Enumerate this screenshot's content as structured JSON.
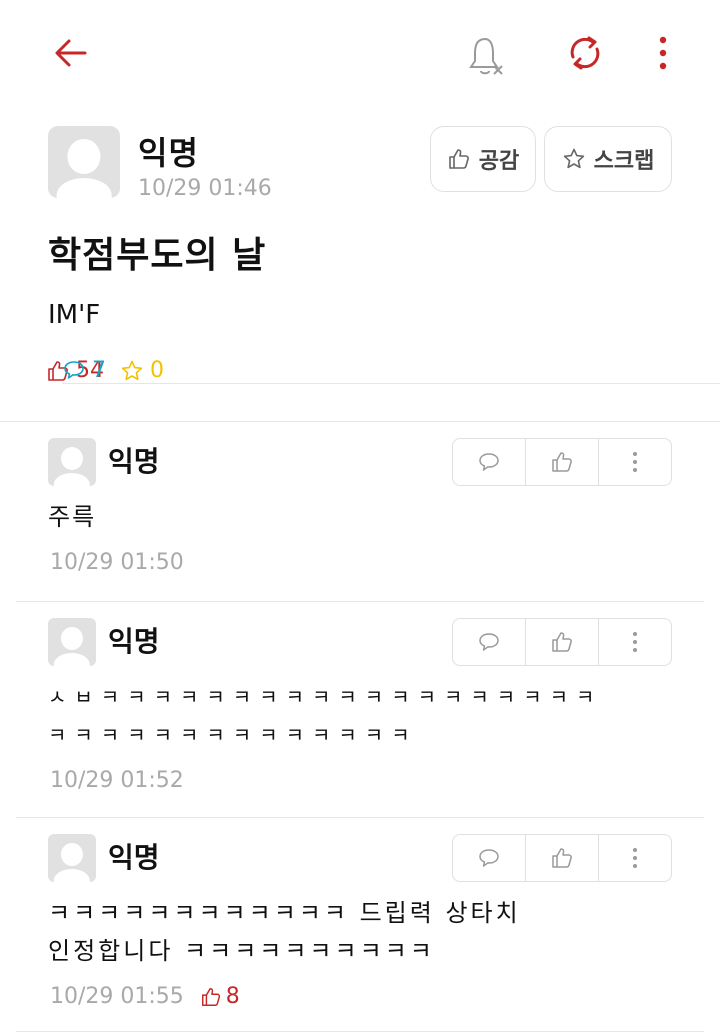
{
  "post": {
    "author": "익명",
    "date": "10/29 01:46",
    "like_button": "공감",
    "scrap_button": "스크랩",
    "title": "학점부도의 날",
    "body": "IM'F",
    "stats": {
      "likes": "54",
      "comments": "7",
      "scraps": "0"
    }
  },
  "comments": [
    {
      "author": "익명",
      "text": "주륵",
      "date": "10/29 01:50"
    },
    {
      "author": "익명",
      "text": "ㅅㅂㅋㅋㅋㅋㅋㅋㅋㅋㅋㅋㅋㅋㅋㅋㅋㅋㅋㅋㅋ\nㅋㅋㅋㅋㅋㅋㅋㅋㅋㅋㅋㅋㅋㅋ",
      "date": "10/29 01:52"
    },
    {
      "author": "익명",
      "text": "ㅋㅋㅋㅋㅋㅋㅋㅋㅋㅋㅋㅋ 드립력 상타치\n인정합니다 ㅋㅋㅋㅋㅋㅋㅋㅋㅋㅋ",
      "date": "10/29 01:55",
      "likes": "8"
    }
  ],
  "colors": {
    "accent": "#c62828",
    "comment": "#10a6c8",
    "scrap": "#f2c200",
    "meta": "#a9a9a9"
  },
  "icons": [
    "back-arrow-icon",
    "bell-off-icon",
    "refresh-icon",
    "more-vertical-icon",
    "thumbs-up-icon",
    "star-icon",
    "speech-bubble-icon"
  ]
}
